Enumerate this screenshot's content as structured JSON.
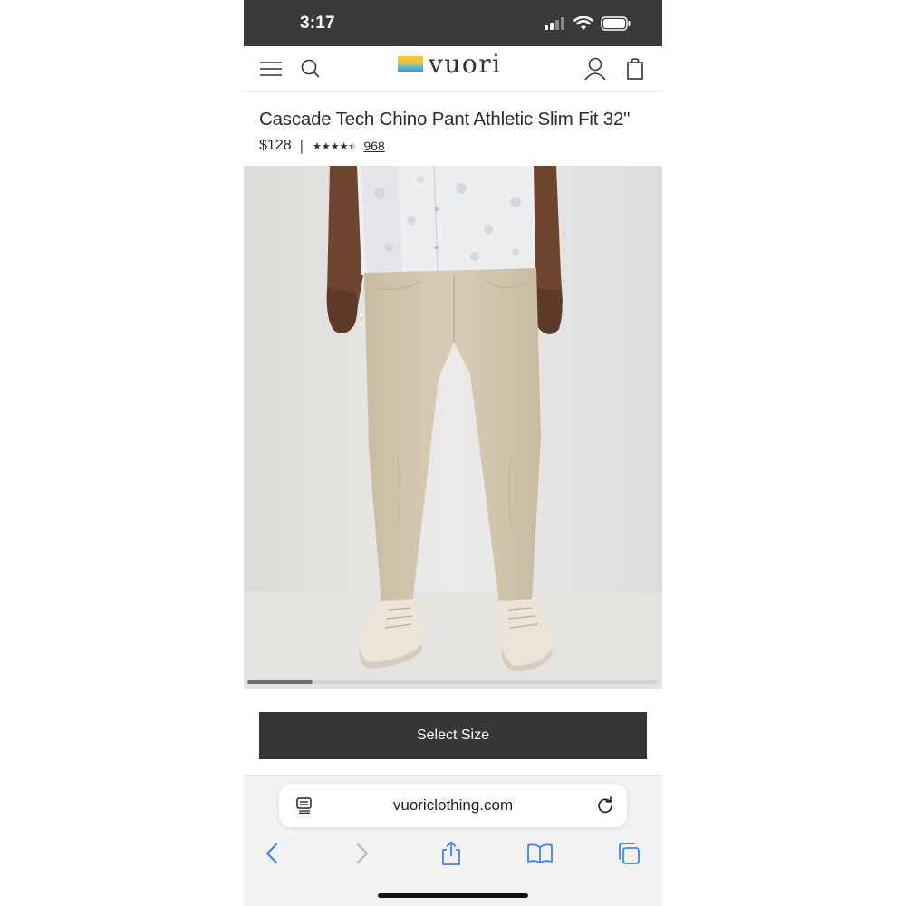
{
  "status_bar": {
    "time": "3:17"
  },
  "header": {
    "brand": "vuori",
    "menu_icon": "hamburger-menu-icon",
    "search_icon": "search-icon",
    "account_icon": "user-icon",
    "cart_icon": "shopping-bag-icon"
  },
  "product": {
    "title": "Cascade Tech Chino Pant Athletic Slim Fit 32\"",
    "price": "$128",
    "separator": "|",
    "rating": 4.5,
    "rating_max": 5,
    "review_count": "968",
    "image_carousel_progress": 0.16
  },
  "cta": {
    "select_size_label": "Select Size"
  },
  "browser": {
    "url": "vuoriclothing.com",
    "reader_icon": "reader-mode-icon",
    "reload_icon": "reload-icon",
    "toolbar": [
      "back-icon",
      "forward-icon",
      "share-icon",
      "bookmarks-icon",
      "tabs-icon"
    ]
  },
  "colors": {
    "status_bar_bg": "#3a3a3a",
    "button_bg": "#373737",
    "pants": "#d6cbb6",
    "shirt": "#eceef0",
    "skin": "#6e4630",
    "safari_blue": "#3c86e6"
  }
}
